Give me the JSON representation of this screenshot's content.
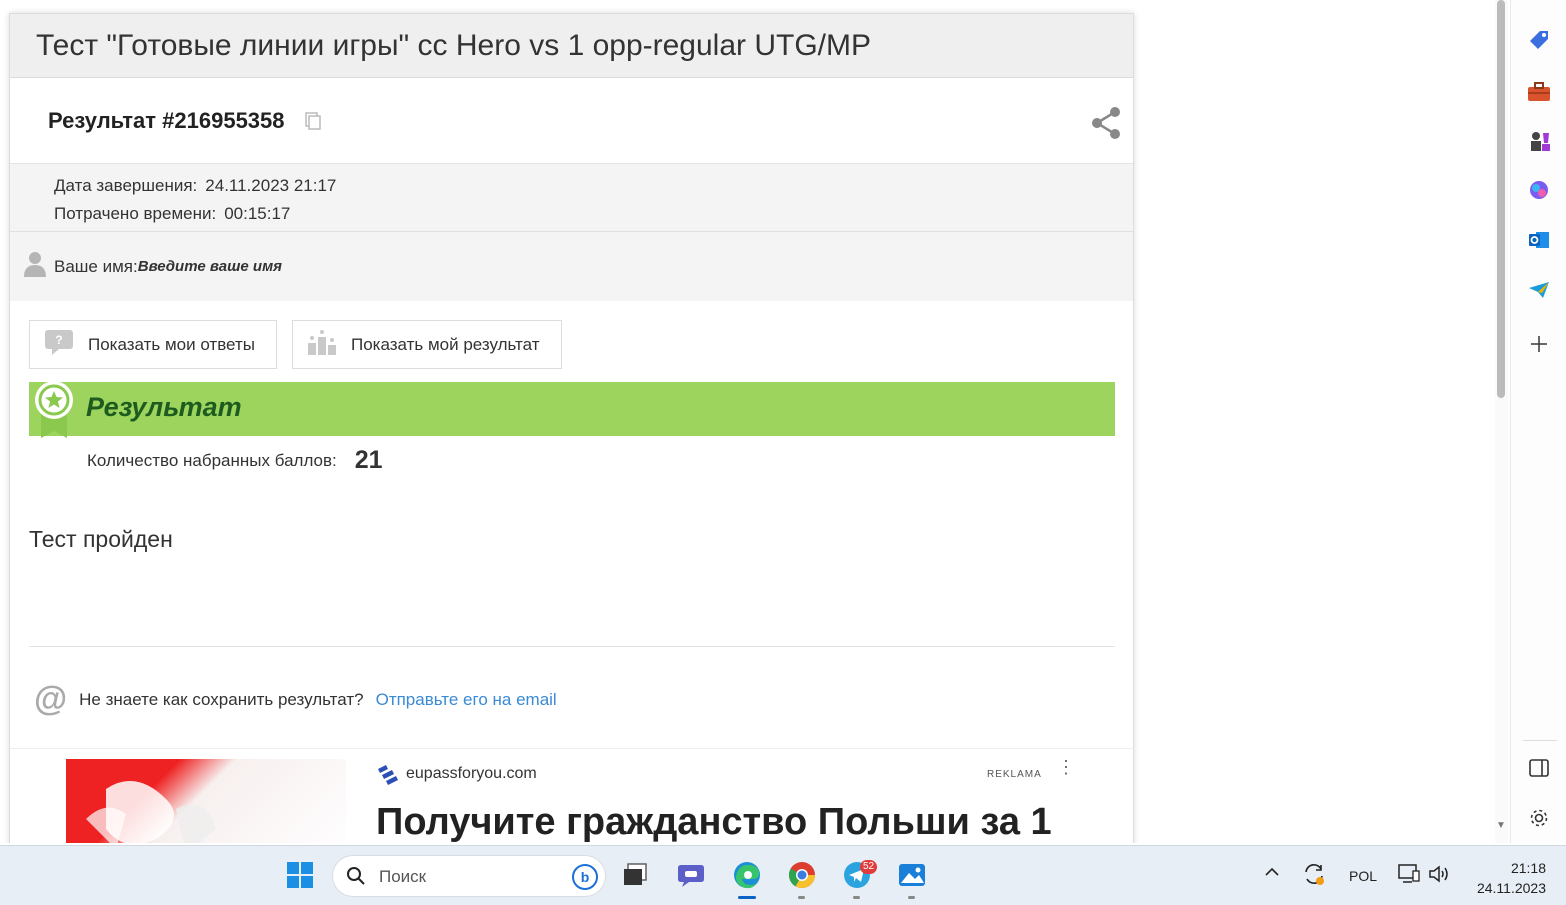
{
  "card": {
    "title": "Тест \"Готовые линии игры\" cc Hero vs 1 opp-regular UTG/MP",
    "result_number": "Результат #216955358",
    "meta": {
      "finish_label": "Дата завершения:",
      "finish_value": "24.11.2023 21:17",
      "spent_label": "Потрачено времени:",
      "spent_value": "00:15:17"
    },
    "name_label": "Ваше имя:",
    "name_value": "Введите ваше имя",
    "buttons": {
      "show_answers": "Показать мои ответы",
      "show_result": "Показать мой результат"
    },
    "result_title": "Результат",
    "score_label": "Количество набранных баллов:",
    "score_value": "21",
    "passed_text": "Тест пройден",
    "save_question": "Не знаете как сохранить результат?",
    "save_link": "Отправьте его на email"
  },
  "ad": {
    "domain": "eupassforyou.com",
    "label": "REKLAMA",
    "title": "Получите гражданство Польши за 1"
  },
  "taskbar": {
    "search_placeholder": "Поиск",
    "telegram_badge": "52",
    "language": "POL",
    "time": "21:18",
    "date": "24.11.2023"
  },
  "colors": {
    "result_bar": "#9cd45e",
    "result_title": "#1e5b1e",
    "link": "#3a8ad6"
  }
}
